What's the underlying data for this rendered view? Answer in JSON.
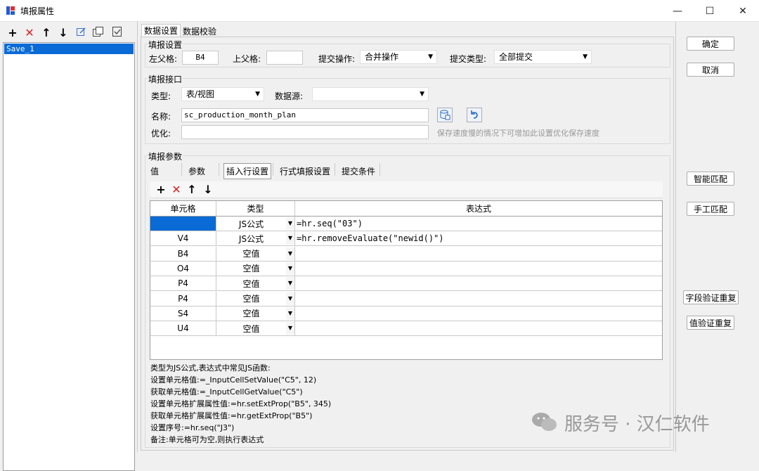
{
  "window": {
    "title": "填报属性",
    "minimize": "—",
    "maximize": "☐",
    "close": "✕"
  },
  "left_toolbar": {
    "add": "+",
    "delete": "✕",
    "up": "↑",
    "down": "↓"
  },
  "save_list": {
    "items": [
      "Save_1"
    ]
  },
  "main_tabs": [
    "数据设置",
    "数据校验"
  ],
  "submit_settings": {
    "group_title": "填报设置",
    "left_parent_label": "左父格:",
    "left_parent_value": "B4",
    "top_parent_label": "上父格:",
    "top_parent_value": "",
    "submit_op_label": "提交操作:",
    "submit_op_value": "合并操作",
    "submit_type_label": "提交类型:",
    "submit_type_value": "全部提交"
  },
  "submit_interface": {
    "group_title": "填报接口",
    "type_label": "类型:",
    "type_value": "表/视图",
    "datasource_label": "数据源:",
    "datasource_value": "",
    "name_label": "名称:",
    "name_value": "sc_production_month_plan",
    "optimize_label": "优化:",
    "optimize_value": "",
    "optimize_hint": "保存速度慢的情况下可增加此设置优化保存速度"
  },
  "params": {
    "group_title": "填报参数",
    "subtabs": [
      "值",
      "参数",
      "插入行设置",
      "行式填报设置",
      "提交条件"
    ],
    "toolbar": {
      "add": "+",
      "delete": "✕",
      "up": "↑",
      "down": "↓"
    },
    "columns": [
      "单元格",
      "类型",
      "表达式"
    ],
    "rows": [
      {
        "cell": "",
        "type": "JS公式",
        "expr": "=hr.seq(\"03\")"
      },
      {
        "cell": "V4",
        "type": "JS公式",
        "expr": "=hr.removeEvaluate(\"newid()\")"
      },
      {
        "cell": "B4",
        "type": "空值",
        "expr": ""
      },
      {
        "cell": "O4",
        "type": "空值",
        "expr": ""
      },
      {
        "cell": "P4",
        "type": "空值",
        "expr": ""
      },
      {
        "cell": "P4",
        "type": "空值",
        "expr": ""
      },
      {
        "cell": "S4",
        "type": "空值",
        "expr": ""
      },
      {
        "cell": "U4",
        "type": "空值",
        "expr": ""
      }
    ]
  },
  "help": {
    "lines": [
      "类型为JS公式,表达式中常见JS函数:",
      "设置单元格值:=_InputCellSetValue(\"C5\", 12)",
      "获取单元格值:=_InputCellGetValue(\"C5\")",
      "设置单元格扩展属性值:=hr.setExtProp(\"B5\", 345)",
      "获取单元格扩展属性值:=hr.getExtProp(\"B5\")",
      "设置序号:=hr.seq(\"J3\")",
      "备注:单元格可为空,则执行表达式"
    ]
  },
  "buttons": {
    "ok": "确定",
    "cancel": "取消",
    "smart_match": "智能匹配",
    "manual_match": "手工匹配",
    "field_validate_dup": "字段验证重复",
    "value_validate_dup": "值验证重复"
  },
  "watermark": "服务号 · 汉仁软件"
}
